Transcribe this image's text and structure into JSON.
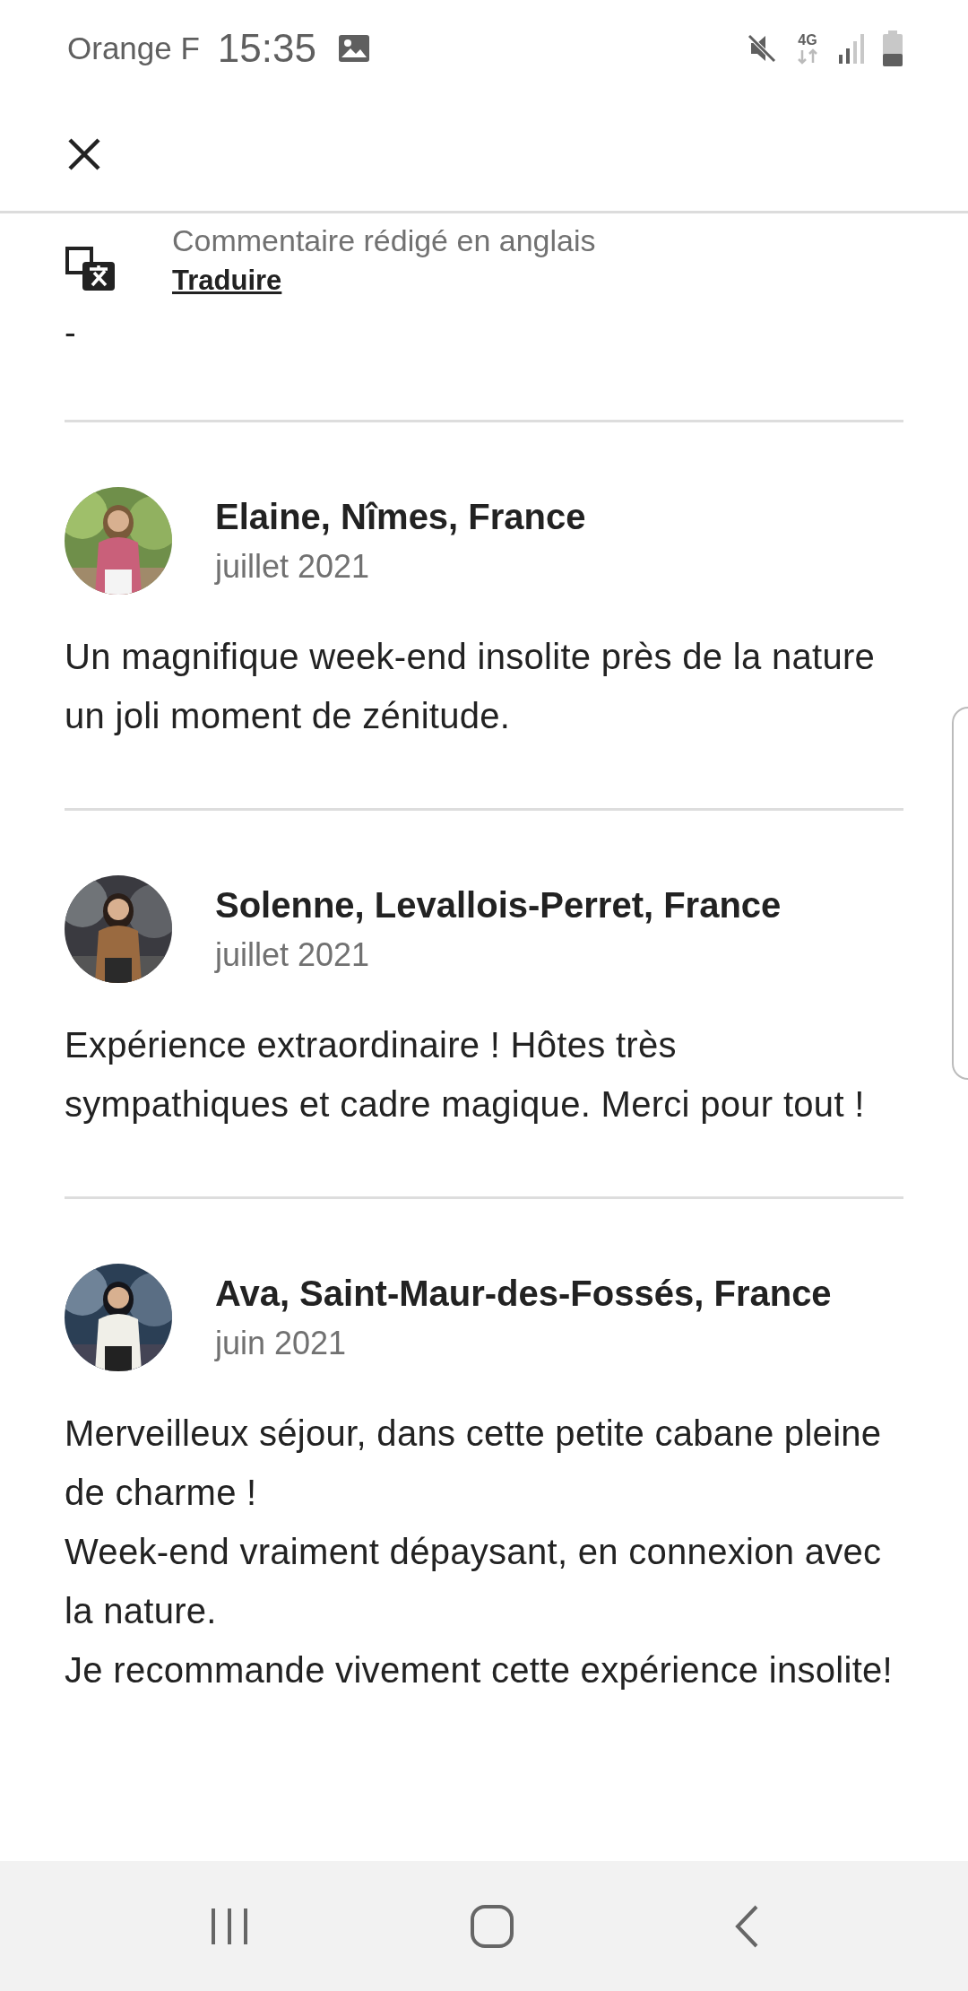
{
  "status_bar": {
    "carrier": "Orange F",
    "time": "15:35",
    "network": "4G"
  },
  "translation": {
    "note": "Commentaire rédigé en anglais",
    "link": "Traduire"
  },
  "previous_comment_tail": "-",
  "reviews": [
    {
      "author": "Elaine, Nîmes, France",
      "date": "juillet 2021",
      "text": "Un magnifique week-end insolite près de la nature un joli moment de zénitude."
    },
    {
      "author": "Solenne, Levallois-Perret, France",
      "date": "juillet 2021",
      "text": "Expérience extraordinaire ! Hôtes très sympathiques et cadre magique. Merci pour tout !"
    },
    {
      "author": "Ava, Saint-Maur-des-Fossés, France",
      "date": "juin 2021",
      "text": "Merveilleux séjour, dans cette petite cabane pleine de charme !\nWeek-end vraiment dépaysant, en connexion avec la nature.\nJe recommande vivement cette expérience insolite!"
    }
  ]
}
